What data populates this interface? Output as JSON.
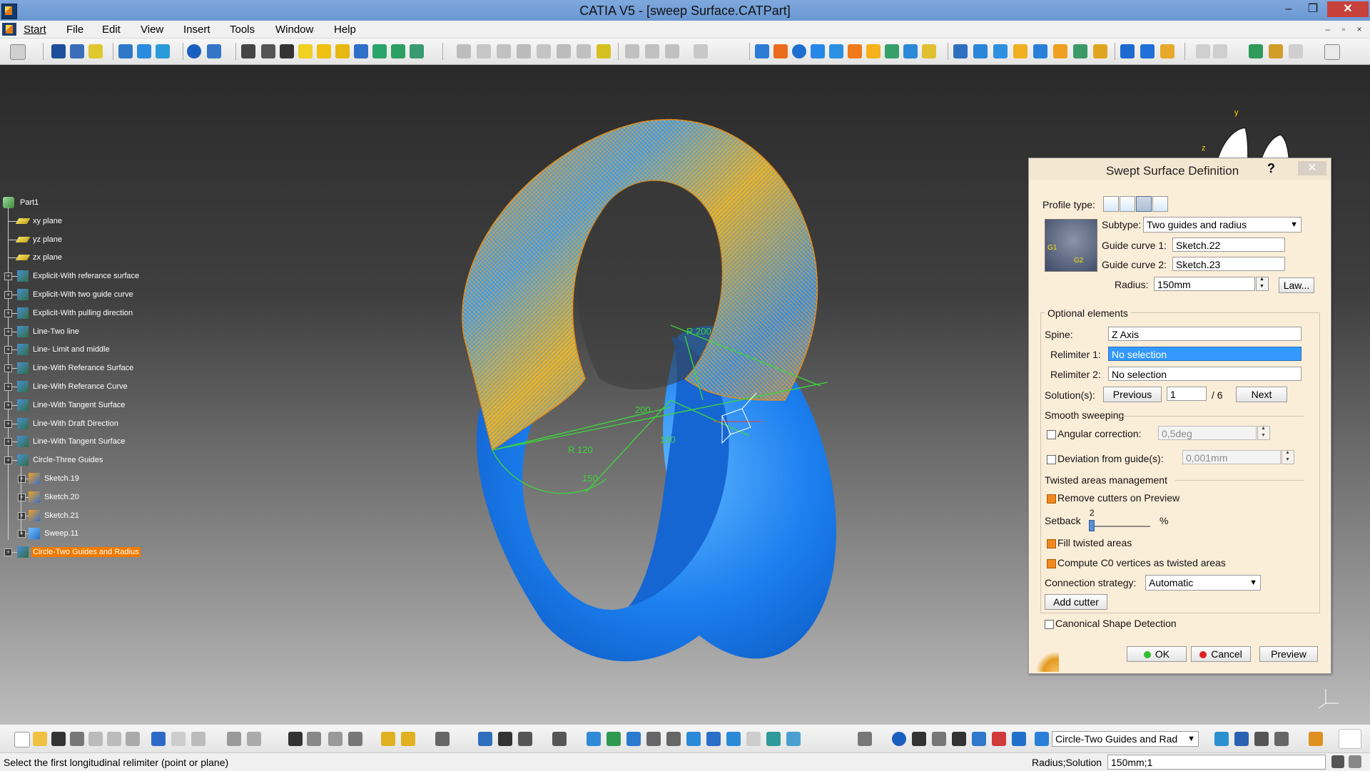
{
  "window": {
    "title": "CATIA V5 - [sweep Surface.CATPart]",
    "minimize": "–",
    "maximize": "❐",
    "close": "✕"
  },
  "menu": {
    "items": [
      "Start",
      "File",
      "Edit",
      "View",
      "Insert",
      "Tools",
      "Window",
      "Help"
    ],
    "mdi_minimize": "–",
    "mdi_restore": "▫",
    "mdi_close": "×"
  },
  "tree": {
    "root": "Part1",
    "nodes": [
      {
        "label": "xy plane",
        "icon": "plane-icon"
      },
      {
        "label": "yz plane",
        "icon": "plane-icon"
      },
      {
        "label": "zx plane",
        "icon": "plane-icon"
      },
      {
        "label": "Explicit-With referance surface",
        "icon": "geometrical-set-icon"
      },
      {
        "label": "Explicit-With two guide curve",
        "icon": "geometrical-set-icon"
      },
      {
        "label": "Explicit-With pulling direction",
        "icon": "geometrical-set-icon"
      },
      {
        "label": "Line-Two line",
        "icon": "geometrical-set-icon"
      },
      {
        "label": "Line- Limit and middle",
        "icon": "geometrical-set-icon"
      },
      {
        "label": "Line-With Referance Surface",
        "icon": "geometrical-set-icon"
      },
      {
        "label": "Line-With Referance Curve",
        "icon": "geometrical-set-icon"
      },
      {
        "label": "Line-With Tangent Surface",
        "icon": "geometrical-set-icon"
      },
      {
        "label": "Line-With Draft Direction",
        "icon": "geometrical-set-icon"
      },
      {
        "label": "Line-With Tangent Surface",
        "icon": "geometrical-set-icon"
      },
      {
        "label": "Circle-Three Guides",
        "icon": "geometrical-set-icon"
      },
      {
        "label": "Sketch.19",
        "icon": "sketch-icon"
      },
      {
        "label": "Sketch.20",
        "icon": "sketch-icon"
      },
      {
        "label": "Sketch.21",
        "icon": "sketch-icon"
      },
      {
        "label": "Sweep.11",
        "icon": "sweep-icon"
      },
      {
        "label": "Circle-Two Guides and Radius",
        "icon": "geometrical-set-icon"
      }
    ]
  },
  "compass": {
    "y": "y",
    "z": "z"
  },
  "annotations": [
    "R 200",
    "200",
    "150",
    "R 120",
    "150"
  ],
  "dialog": {
    "title": "Swept Surface Definition",
    "help": "?",
    "close": "✕",
    "profile_type_label": "Profile type:",
    "subtype_label": "Subtype:",
    "subtype_value": "Two guides and radius",
    "guide_curve_1_label": "Guide curve 1:",
    "guide_curve_1_value": "Sketch.22",
    "guide_curve_2_label": "Guide curve 2:",
    "guide_curve_2_value": "Sketch.23",
    "radius_label": "Radius:",
    "radius_value": "150mm",
    "law_button": "Law...",
    "preview_labels": {
      "g1": "G1",
      "g2": "G2"
    },
    "optional_elements": "Optional elements",
    "spine_label": "Spine:",
    "spine_value": "Z Axis",
    "relimiter1_label": "Relimiter 1:",
    "relimiter1_value": "No selection",
    "relimiter2_label": "Relimiter 2:",
    "relimiter2_value": "No selection",
    "solutions_label": "Solution(s):",
    "previous_button": "Previous",
    "solution_value": "1",
    "solution_total": "/ 6",
    "next_button": "Next",
    "smooth_sweeping": "Smooth sweeping",
    "angular_correction_label": "Angular correction:",
    "angular_correction_value": "0,5deg",
    "deviation_label": "Deviation from guide(s):",
    "deviation_value": "0,001mm",
    "twisted_areas": "Twisted areas management",
    "remove_cutters_label": "Remove cutters on Preview",
    "setback_label": "Setback",
    "setback_value": "2",
    "setback_unit": "%",
    "setback_fraction": 0.04,
    "fill_twisted_label": "Fill twisted areas",
    "compute_c0_label": "Compute C0 vertices as twisted areas",
    "connection_strategy_label": "Connection strategy:",
    "connection_strategy_value": "Automatic",
    "add_cutter_button": "Add cutter",
    "canonical_label": "Canonical Shape Detection",
    "ok_button": "OK",
    "cancel_button": "Cancel",
    "preview_button": "Preview"
  },
  "bottom_toolbar": {
    "current_set": "Circle-Two Guides and Rad"
  },
  "status": {
    "message": "Select the first longitudinal relimiter (point or plane)",
    "prompt_label": "Radius;Solution",
    "prompt_value": "150mm;1"
  },
  "colors": {
    "accent_orange": "#f07a00",
    "surface_blue": "#1a7df0",
    "selection_blue": "#3399ff"
  }
}
